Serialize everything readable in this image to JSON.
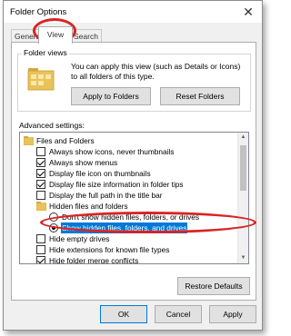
{
  "window": {
    "title": "Folder Options",
    "close_glyph": "✕"
  },
  "tabs": [
    {
      "label": "General",
      "active": false
    },
    {
      "label": "View",
      "active": true
    },
    {
      "label": "Search",
      "active": false
    }
  ],
  "folder_views": {
    "label": "Folder views",
    "description": "You can apply this view (such as Details or Icons) to all folders of this type.",
    "apply_button": "Apply to Folders",
    "reset_button": "Reset Folders"
  },
  "advanced": {
    "label": "Advanced settings:",
    "items": [
      {
        "type": "folder",
        "label": "Files and Folders"
      },
      {
        "type": "checkbox",
        "checked": false,
        "label": "Always show icons, never thumbnails"
      },
      {
        "type": "checkbox",
        "checked": true,
        "label": "Always show menus"
      },
      {
        "type": "checkbox",
        "checked": true,
        "label": "Display file icon on thumbnails"
      },
      {
        "type": "checkbox",
        "checked": true,
        "label": "Display file size information in folder tips"
      },
      {
        "type": "checkbox",
        "checked": false,
        "label": "Display the full path in the title bar"
      },
      {
        "type": "folder",
        "label": "Hidden files and folders"
      },
      {
        "type": "radio",
        "checked": false,
        "label": "Don't show hidden files, folders, or drives"
      },
      {
        "type": "radio",
        "checked": true,
        "label": "Show hidden files, folders, and drives"
      },
      {
        "type": "checkbox",
        "checked": false,
        "label": "Hide empty drives"
      },
      {
        "type": "checkbox",
        "checked": true,
        "label": "Hide extensions for known file types"
      },
      {
        "type": "checkbox",
        "checked": true,
        "label": "Hide folder merge conflicts"
      }
    ]
  },
  "restore_button": "Restore Defaults",
  "dialog_buttons": {
    "ok": "OK",
    "cancel": "Cancel",
    "apply": "Apply"
  },
  "colors": {
    "selection": "#0078d7",
    "highlight_ring": "#d92424",
    "folder": "#e8c35a"
  }
}
